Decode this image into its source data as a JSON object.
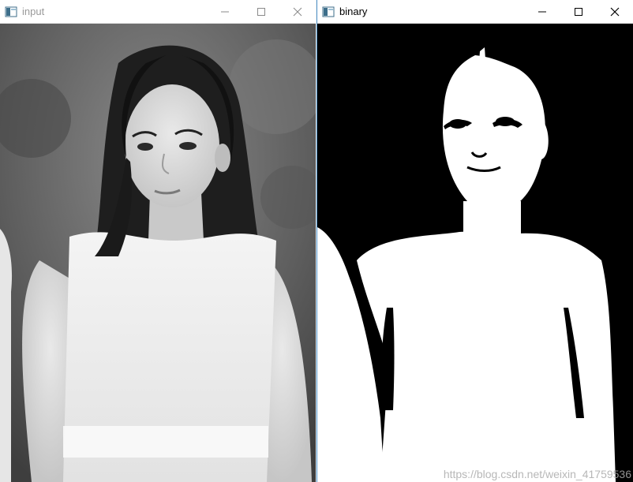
{
  "windows": {
    "input": {
      "title": "input"
    },
    "binary": {
      "title": "binary"
    }
  },
  "icons": {
    "app": "opencv-window-icon",
    "minimize": "minimize-icon",
    "maximize": "maximize-icon",
    "close": "close-icon"
  },
  "watermark": {
    "text": "https://blog.csdn.net/weixin_41759536"
  },
  "colors": {
    "binary_active_border": "#4a90c8",
    "binary_foreground": "#ffffff",
    "binary_background": "#000000"
  }
}
